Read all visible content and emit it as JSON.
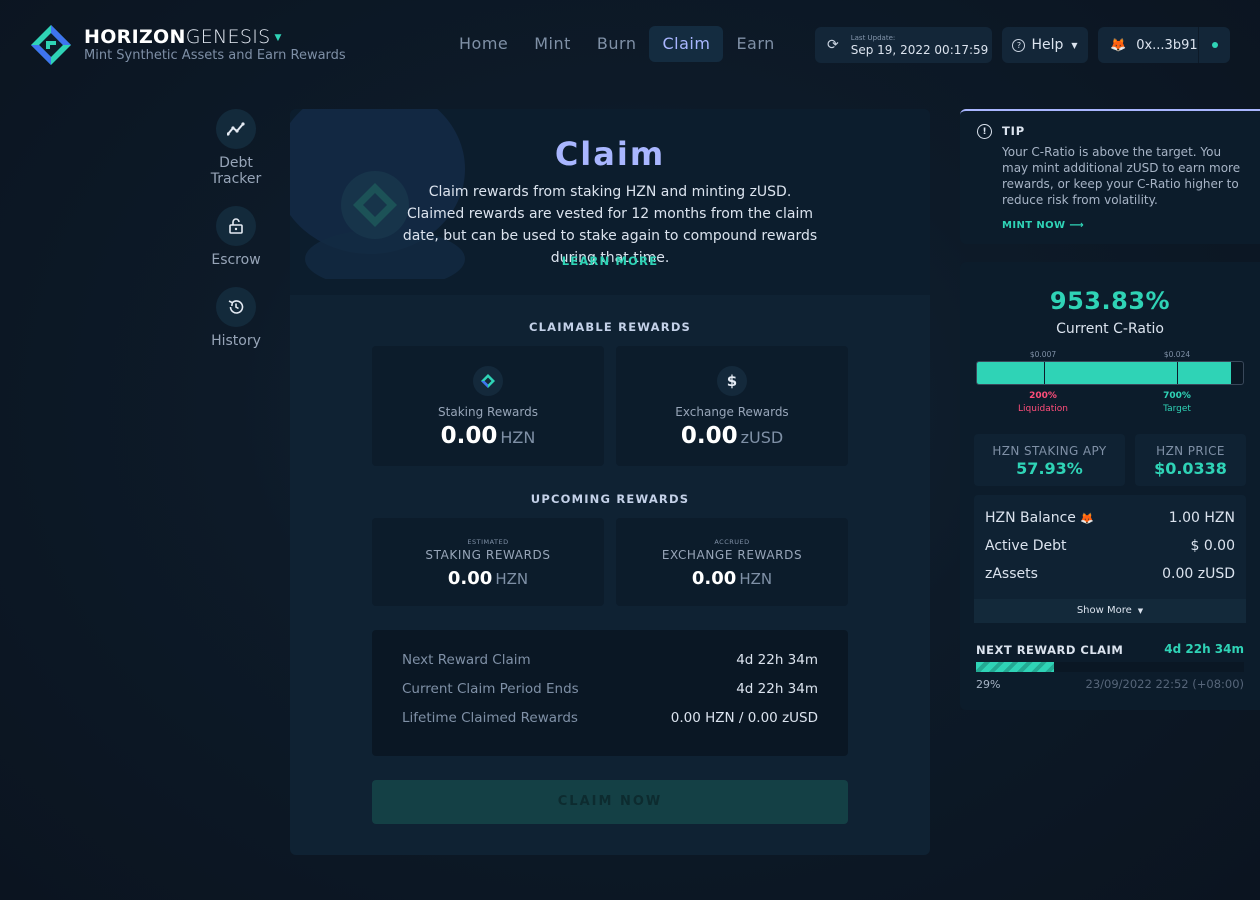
{
  "header": {
    "brand_bold": "HORIZON",
    "brand_thin": "GENESIS",
    "tagline": "Mint Synthetic Assets and Earn Rewards",
    "nav": [
      "Home",
      "Mint",
      "Burn",
      "Claim",
      "Earn"
    ],
    "active_nav": "Claim",
    "last_update_label": "Last Update:",
    "last_update_time": "Sep 19, 2022 00:17:59",
    "help_label": "Help",
    "wallet_address": "0x...3b91"
  },
  "sidebar": {
    "items": [
      {
        "label": "Debt Tracker",
        "icon": "chart-line-icon"
      },
      {
        "label": "Escrow",
        "icon": "lock-open-icon"
      },
      {
        "label": "History",
        "icon": "history-icon"
      }
    ]
  },
  "claim": {
    "title": "Claim",
    "description": "Claim rewards from staking HZN and minting zUSD. Claimed rewards are vested for 12 months from the claim date, but can be used to stake again to compound rewards during that time.",
    "learn_more": "LEARN MORE",
    "claimable_title": "CLAIMABLE REWARDS",
    "staking_label": "Staking Rewards",
    "staking_value": "0.00",
    "staking_unit": "HZN",
    "exchange_label": "Exchange Rewards",
    "exchange_icon": "$",
    "exchange_value": "0.00",
    "exchange_unit": "zUSD",
    "upcoming_title": "UPCOMING REWARDS",
    "up_staking_tag": "ESTIMATED",
    "up_staking_label": "STAKING REWARDS",
    "up_staking_value": "0.00",
    "up_staking_unit": "HZN",
    "up_exchange_tag": "ACCRUED",
    "up_exchange_label": "EXCHANGE REWARDS",
    "up_exchange_value": "0.00",
    "up_exchange_unit": "HZN",
    "info": [
      {
        "k": "Next Reward Claim",
        "v": "4d 22h 34m"
      },
      {
        "k": "Current Claim Period Ends",
        "v": "4d 22h 34m"
      },
      {
        "k": "Lifetime Claimed Rewards",
        "v": "0.00 HZN / 0.00 zUSD"
      }
    ],
    "claim_button": "CLAIM NOW"
  },
  "tip": {
    "title": "TIP",
    "text": "Your C-Ratio is above the target. You may mint additional zUSD to earn more rewards, or keep your C-Ratio higher to reduce risk from volatility.",
    "link": "MINT NOW ⟶"
  },
  "stats": {
    "c_ratio": "953.83%",
    "c_ratio_label": "Current C-Ratio",
    "ratio_fill_fraction": 0.955,
    "liquidation_marker_fraction": 0.25,
    "target_marker_fraction": 0.75,
    "liquidation_price": "$0.007",
    "target_price": "$0.024",
    "liquidation_pct": "200%",
    "liquidation_label": "Liquidation",
    "target_pct": "700%",
    "target_label": "Target",
    "apy_label": "HZN STAKING APY",
    "apy_value": "57.93%",
    "price_label": "HZN PRICE",
    "price_value": "$0.0338",
    "balances": [
      {
        "k": "HZN Balance",
        "v": "1.00 HZN"
      },
      {
        "k": "Active Debt",
        "v": "$ 0.00"
      },
      {
        "k": "zAssets",
        "v": "0.00 zUSD"
      }
    ],
    "show_more": "Show More",
    "next_reward_title": "NEXT REWARD CLAIM",
    "next_reward_time": "4d 22h 34m",
    "progress_fraction": 0.29,
    "progress_pct": "29%",
    "progress_date": "23/09/2022 22:52 (+08:00)"
  },
  "colors": {
    "accent_teal": "#2fd3b6",
    "accent_lavender": "#a9b6ff",
    "danger_pink": "#ff4d7a"
  }
}
